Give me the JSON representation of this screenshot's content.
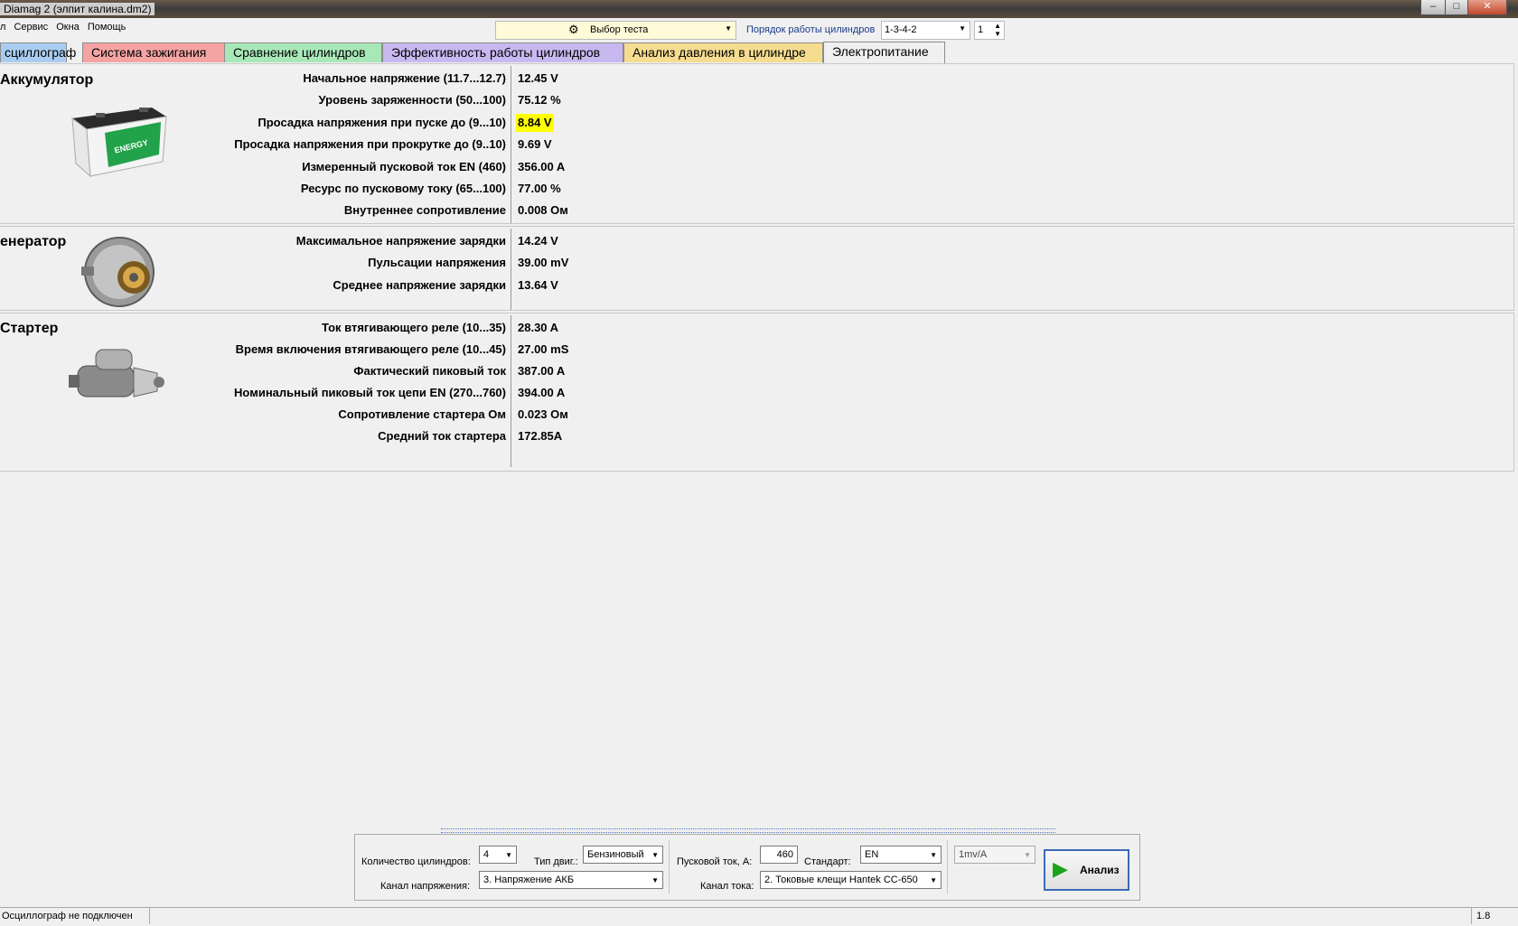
{
  "window": {
    "title": "Diamag 2 (элпит калина.dm2)",
    "minimize": "–",
    "maximize": "□",
    "close": "✕"
  },
  "menu": [
    "л",
    "Сервис",
    "Окна",
    "Помощь"
  ],
  "toolbar": {
    "test_select": "Выбор теста",
    "firing_order_label": "Порядок работы цилиндров",
    "firing_order_value": "1-3-4-2",
    "spinner_value": "1"
  },
  "tabs": [
    {
      "label": "сциллограф",
      "color": "#a9cdf0"
    },
    {
      "label": "Система зажигания",
      "color": "#f5a3a3"
    },
    {
      "label": "Сравнение цилиндров",
      "color": "#a8e8b8"
    },
    {
      "label": "Эффективность работы цилиндров",
      "color": "#c8b8f0"
    },
    {
      "label": "Анализ давления в цилиндре",
      "color": "#f5dc90"
    },
    {
      "label": "Электропитание",
      "color": "#f0f0f0"
    }
  ],
  "battery": {
    "title": "Аккумулятор",
    "image_text": "ENERGY",
    "rows": [
      {
        "label": "Начальное напряжение (11.7...12.7)",
        "value": "12.45 V"
      },
      {
        "label": "Уровень заряженности (50...100)",
        "value": "75.12 %"
      },
      {
        "label": "Просадка напряжения при пуске до (9...10)",
        "value": "8.84 V",
        "highlight": "#ffff00"
      },
      {
        "label": "Просадка напряжения при прокрутке до  (9..10)",
        "value": "9.69 V"
      },
      {
        "label": "Измеренный пусковой ток  EN (460)",
        "value": "356.00 A"
      },
      {
        "label": "Ресурс по пусковому току (65...100)",
        "value": "77.00 %"
      },
      {
        "label": "Внутреннее сопротивление",
        "value": "0.008 Ом"
      }
    ]
  },
  "generator": {
    "title": "енератор",
    "rows": [
      {
        "label": "Максимальное напряжение зарядки",
        "value": "14.24 V"
      },
      {
        "label": "Пульсации напряжения",
        "value": "39.00 mV"
      },
      {
        "label": "Среднее напряжение зарядки",
        "value": "13.64 V"
      }
    ]
  },
  "starter": {
    "title": "Стартер",
    "rows": [
      {
        "label": "Ток втягивающего реле (10...35)",
        "value": "28.30 A"
      },
      {
        "label": "Время включения втягивающего реле (10...45)",
        "value": "27.00 mS"
      },
      {
        "label": "Фактический пиковый ток",
        "value": "387.00 A"
      },
      {
        "label": "Номинальный пиковый ток цепи EN (270...760)",
        "value": "394.00 A"
      },
      {
        "label": "Сопротивление стартера Ом",
        "value": "0.023 Ом"
      },
      {
        "label": "Средний ток стартера",
        "value": "172.85A"
      }
    ]
  },
  "settings": {
    "cylinders_label": "Количество цилиндров:",
    "cylinders_value": "4",
    "engine_type_label": "Тип двиг.:",
    "engine_type_value": "Бензиновый",
    "voltage_channel_label": "Канал напряжения:",
    "voltage_channel_value": "3.  Напряжение АКБ",
    "start_current_label": "Пусковой ток, А:",
    "start_current_value": "460",
    "standard_label": "Стандарт:",
    "standard_value": "EN",
    "current_channel_label": "Канал тока:",
    "current_channel_value": "2.  Токовые клещи Hantek CC-650",
    "scale_value": "1mv/A",
    "analyze_button": "Анализ"
  },
  "status": {
    "left": "Осциллограф не подключен",
    "right": "1.8"
  }
}
